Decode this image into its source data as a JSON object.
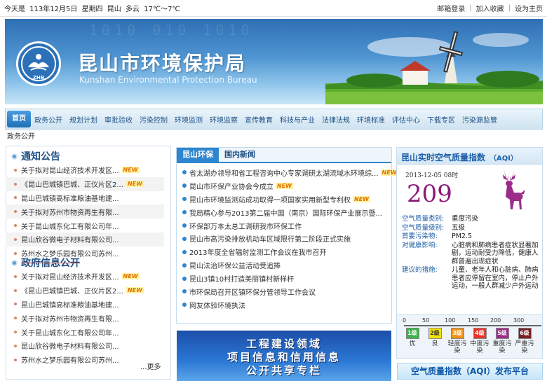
{
  "topbar": {
    "date_parts": [
      "今天是",
      "113年12月5日",
      "星期四",
      "昆山",
      "多云",
      "17℃～7℃"
    ],
    "links": [
      "邮箱登录",
      "加入收藏",
      "设为主页"
    ]
  },
  "banner": {
    "title_cn": "昆山市环境保护局",
    "title_en": "Kunshan Environmental Protection Bureau",
    "logo_text": "ZHB"
  },
  "nav": {
    "items": [
      "首页",
      "政务公开",
      "规划计划",
      "审批验收",
      "污染控制",
      "环境监测",
      "环境监察",
      "宣传教育",
      "科技与产业",
      "法律法规",
      "环境标准",
      "评估中心",
      "下载专区",
      "污染源监管"
    ],
    "sub": "政务公开"
  },
  "notice": {
    "title": "通知公告",
    "items": [
      {
        "text": "关于拟对昆山经济技术开发区...",
        "new": "NEW"
      },
      {
        "text": "《昆山巴城镇巴城、正仪片区2...",
        "new": "NEW"
      },
      {
        "text": "昆山巴城镇高标准粮油基地建...",
        "new": ""
      },
      {
        "text": "关于拟对苏州市物资再生有限...",
        "new": ""
      },
      {
        "text": "关于昆山城东化工有限公司年...",
        "new": ""
      },
      {
        "text": "昆山欣谷微电子材料有限公司...",
        "new": ""
      },
      {
        "text": "苏州水之梦乐园有限公司苏州...",
        "new": ""
      }
    ]
  },
  "gov": {
    "title": "政府信息公开",
    "items": [
      {
        "text": "关于拟对昆山经济技术开发区...",
        "new": "NEW"
      },
      {
        "text": "《昆山巴城镇巴城、正仪片区2...",
        "new": "NEW"
      },
      {
        "text": "昆山巴城镇高标准粮油基地建...",
        "new": ""
      },
      {
        "text": "关于拟对苏州市物资再生有限...",
        "new": ""
      },
      {
        "text": "关于昆山城东化工有限公司年...",
        "new": ""
      },
      {
        "text": "昆山欣谷微电子材料有限公司...",
        "new": ""
      },
      {
        "text": "苏州水之梦乐园有限公司苏州...",
        "new": ""
      }
    ],
    "more": "...更多"
  },
  "mid": {
    "tabs": [
      "昆山环保",
      "国内新闻"
    ],
    "items": [
      {
        "text": "省太湖办领导和省工程咨询中心专家调研太湖流域水环境综...",
        "new": "NEW"
      },
      {
        "text": "昆山市环保产业协会今成立",
        "new": "NEW"
      },
      {
        "text": "昆山市环境监测站成功取得一项国家实用新型专利权",
        "new": "NEW"
      },
      {
        "text": "我局精心参与2013第二届中国（南京）国际环保产业展示暨...",
        "new": ""
      },
      {
        "text": "环保部万本太总工调研我市环保工作",
        "new": ""
      },
      {
        "text": "昆山市高污染排放机动车区域限行第二阶段正式实施",
        "new": ""
      },
      {
        "text": "2013年度全省辐射监测工作会议在我市召开",
        "new": ""
      },
      {
        "text": "昆山法治环保公益活动受追捧",
        "new": ""
      },
      {
        "text": "昆山3镇10村打造美丽镇村新样杆",
        "new": ""
      },
      {
        "text": "市环保局召开区镇环保分管领导工作会议",
        "new": ""
      },
      {
        "text": "网友体验环境执法",
        "new": ""
      }
    ]
  },
  "promo": {
    "lines": [
      "工程建设领域",
      "项目信息和信用信息",
      "公开共享专栏"
    ]
  },
  "aqi": {
    "title": "昆山实时空气质量指数",
    "tag": "（AQI）",
    "time": "2013-12-05 08时",
    "value": "209",
    "rows": [
      {
        "k": "空气质量类别:",
        "v": "重度污染"
      },
      {
        "k": "空气质量级别:",
        "v": "五级"
      },
      {
        "k": "首要污染物:",
        "v": "PM2.5"
      },
      {
        "k": "对健康影响:",
        "v": "心脏病和肺病患者症状显著加剧，运动耐受力降低，健康人群普遍出现症状"
      },
      {
        "k": "建议的措施:",
        "v": "儿童、老年人和心脏病、肺病患者应停留在室内，停止户外运动，一般人群减少户外运动"
      }
    ],
    "scale_ticks": [
      "0",
      "50",
      "100",
      "150",
      "200",
      "300"
    ],
    "levels": [
      {
        "box": "1级",
        "name": "优",
        "color": "#3cb14a"
      },
      {
        "box": "2级",
        "name": "良",
        "color": "#f4e200"
      },
      {
        "box": "3级",
        "name": "轻度污染",
        "color": "#f39219"
      },
      {
        "box": "4级",
        "name": "中度污染",
        "color": "#e8362a"
      },
      {
        "box": "5级",
        "name": "重度污染",
        "color": "#9b2c8a"
      },
      {
        "box": "6级",
        "name": "严重污染",
        "color": "#7b1f25"
      }
    ],
    "footer": "空气质量指数（AQI）发布平台"
  }
}
